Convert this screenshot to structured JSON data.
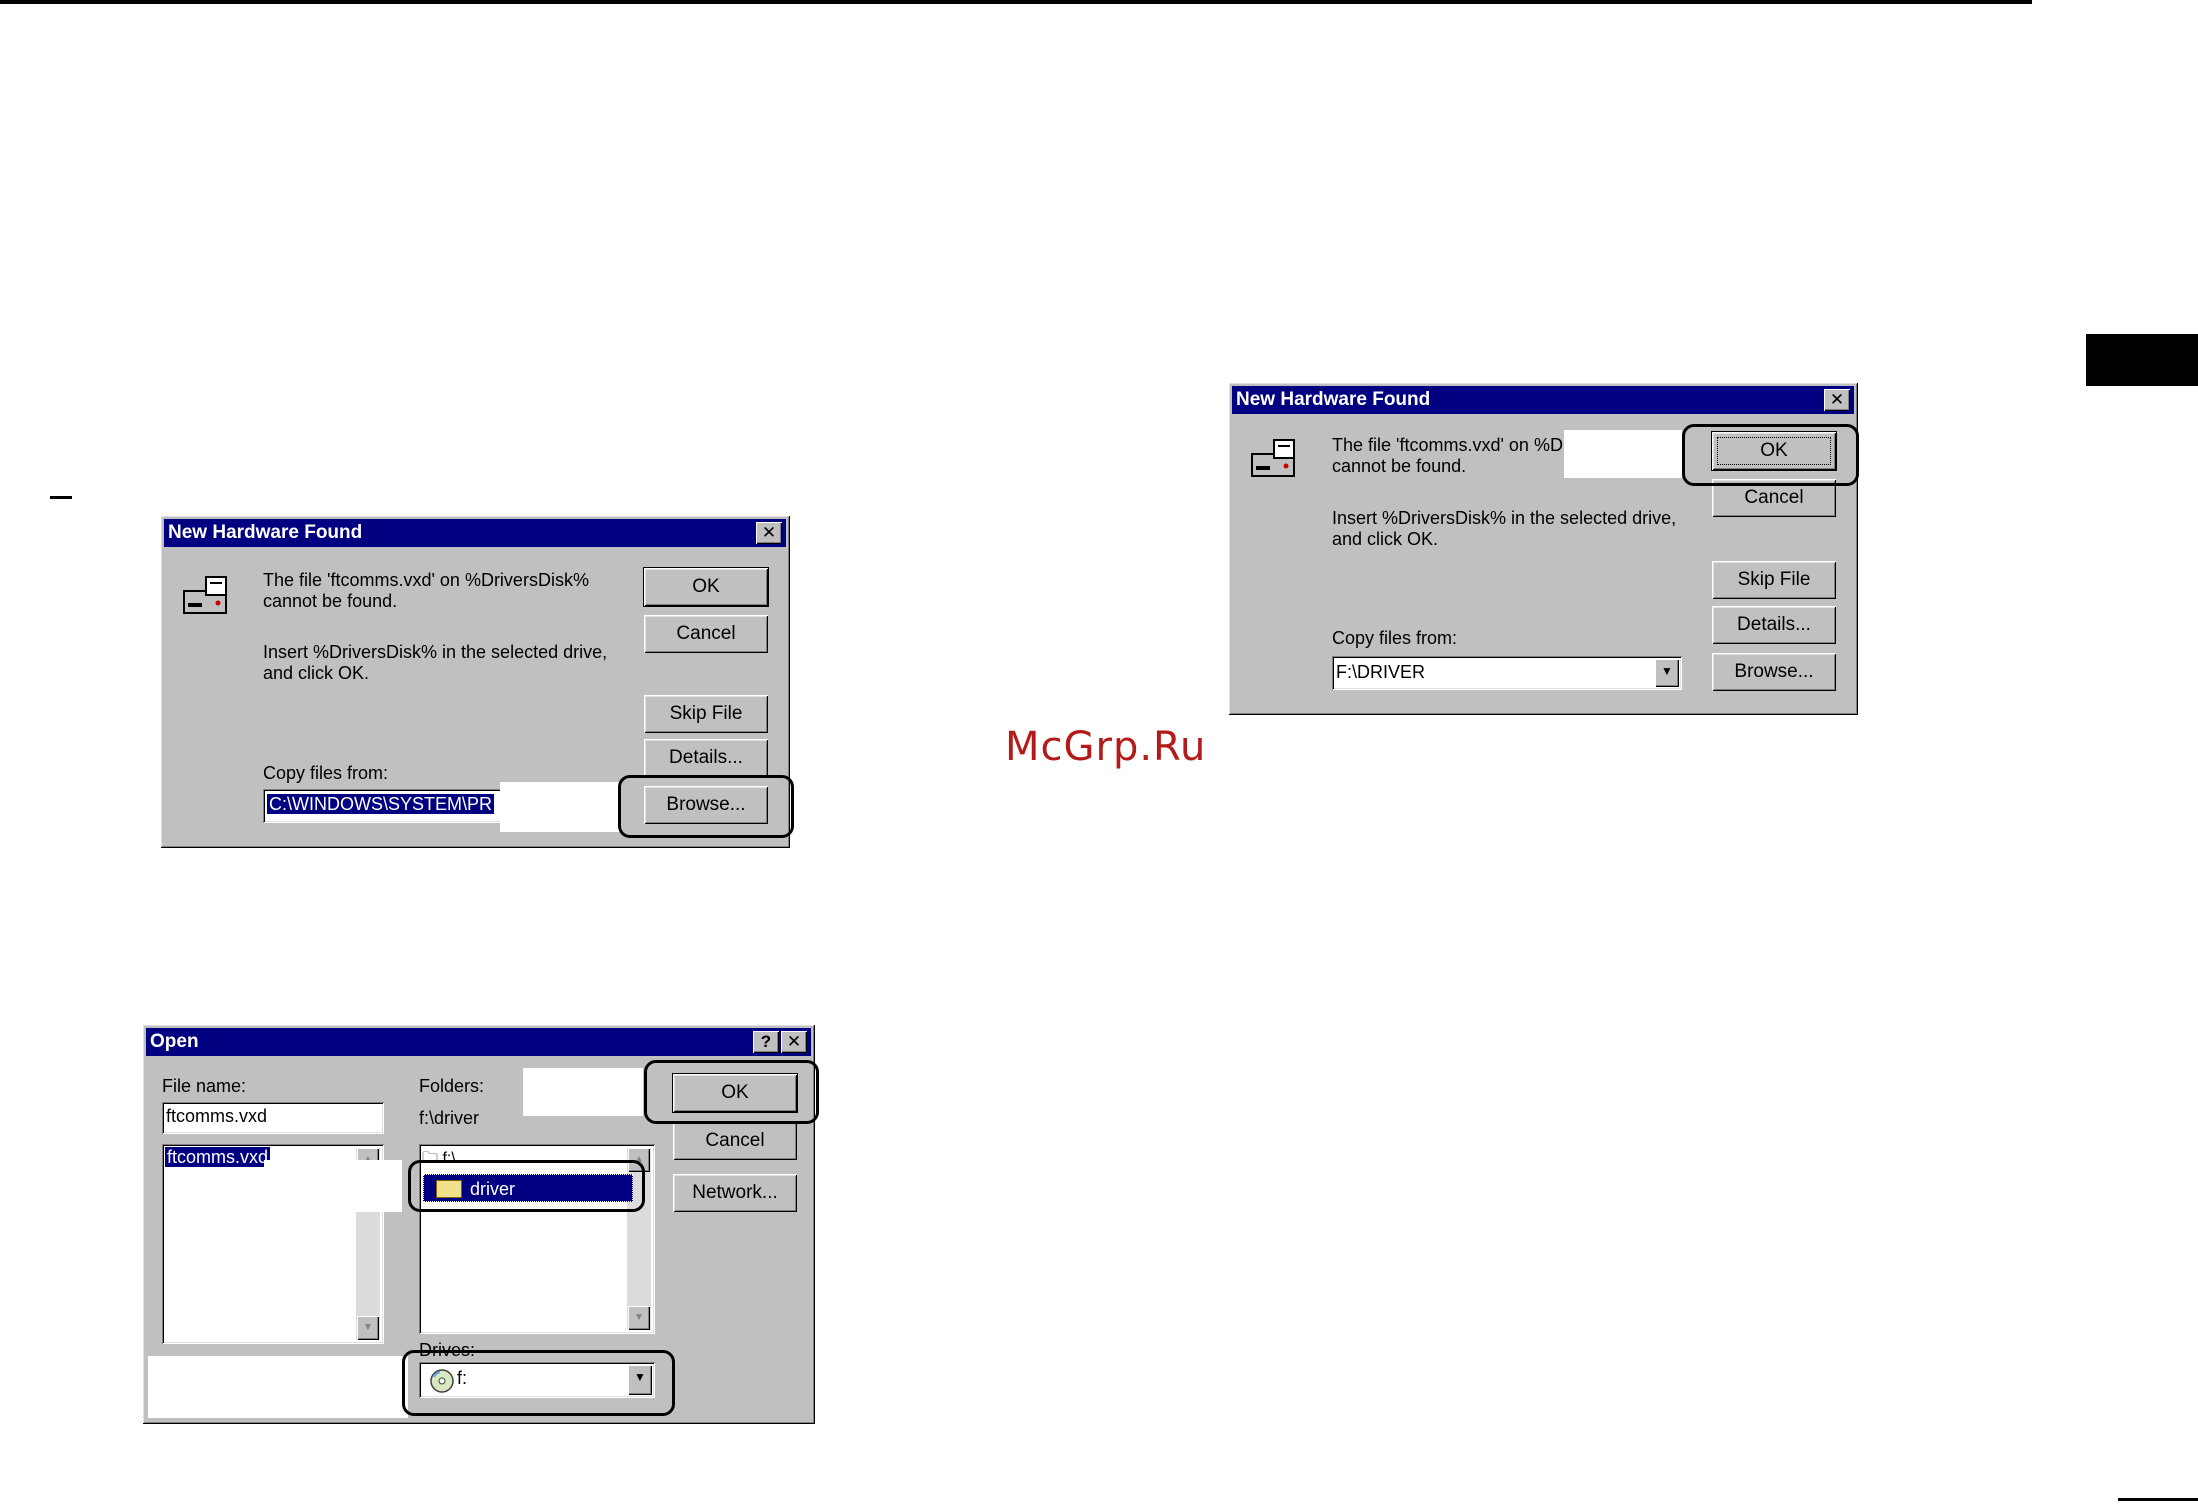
{
  "watermark": "McGrp.Ru",
  "dialog_a": {
    "title": "New Hardware Found",
    "close": "✕",
    "message_1": "The file 'ftcomms.vxd' on %DriversDisk%",
    "message_2": "cannot be found.",
    "message_3": "Insert %DriversDisk% in the selected drive,",
    "message_4": "and click OK.",
    "buttons": {
      "ok": "OK",
      "cancel": "Cancel",
      "skip": "Skip File",
      "details": "Details...",
      "browse": "Browse..."
    },
    "copy_label": "Copy files from:",
    "copy_value": "C:\\WINDOWS\\SYSTEM\\PR"
  },
  "dialog_b": {
    "title": "Open",
    "help": "?",
    "close": "✕",
    "file_name_label": "File name:",
    "file_name_value": "ftcomms.vxd",
    "file_list": [
      "ftcomms.vxd"
    ],
    "folders_label": "Folders:",
    "current_folder": "f:\\driver",
    "folder_root": "f:\\",
    "folder_selected": "driver",
    "drives_label": "Drives:",
    "drive_value": "f:",
    "buttons": {
      "ok": "OK",
      "cancel": "Cancel",
      "network": "Network..."
    }
  },
  "dialog_c": {
    "title": "New Hardware Found",
    "close": "✕",
    "message_1": "The file 'ftcomms.vxd' on %Dri",
    "message_2": "cannot be found.",
    "message_3": "Insert %DriversDisk% in the selected drive,",
    "message_4": "and click OK.",
    "buttons": {
      "ok": "OK",
      "cancel": "Cancel",
      "skip": "Skip File",
      "details": "Details...",
      "browse": "Browse..."
    },
    "copy_label": "Copy files from:",
    "copy_value": "F:\\DRIVER"
  },
  "colors": {
    "titlebar": "#000080",
    "face": "#c0c0c0",
    "watermark": "#b51a1a"
  }
}
